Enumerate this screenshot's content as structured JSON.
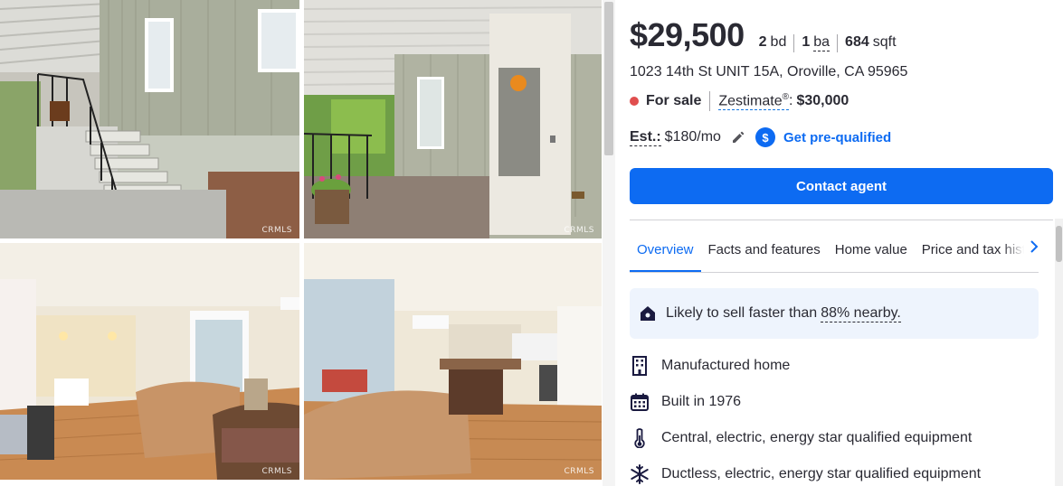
{
  "gallery": {
    "watermark": "CRMLS",
    "photos": [
      {
        "alt": "exterior-stairs"
      },
      {
        "alt": "front-door-porch"
      },
      {
        "alt": "living-room-window"
      },
      {
        "alt": "living-room-kitchen"
      }
    ]
  },
  "listing": {
    "price": "$29,500",
    "beds_value": "2",
    "beds_unit": "bd",
    "baths_value": "1",
    "baths_unit": "ba",
    "sqft_value": "684",
    "sqft_unit": "sqft",
    "address": "1023 14th St UNIT 15A, Oroville, CA 95965",
    "status": "For sale",
    "zestimate_label": "Zestimate",
    "zestimate_reg": "®",
    "zestimate_colon": ":",
    "zestimate_value": "$30,000",
    "est_label": "Est.:",
    "est_value": "$180/mo",
    "prequal_label": "Get pre-qualified",
    "dollar_glyph": "$",
    "contact_label": "Contact agent"
  },
  "tabs": [
    {
      "label": "Overview",
      "active": true
    },
    {
      "label": "Facts and features",
      "active": false
    },
    {
      "label": "Home value",
      "active": false
    },
    {
      "label": "Price and tax history",
      "active": false
    }
  ],
  "hint": {
    "text": "Likely to sell faster than",
    "percent": "88% nearby."
  },
  "features": [
    {
      "icon": "building-icon",
      "text": "Manufactured home"
    },
    {
      "icon": "calendar-icon",
      "text": "Built in 1976"
    },
    {
      "icon": "thermometer-icon",
      "text": "Central, electric, energy star qualified equipment"
    },
    {
      "icon": "snowflake-icon",
      "text": "Ductless, electric, energy star qualified equipment"
    }
  ],
  "colors": {
    "accent": "#0d6bf2",
    "status_dot": "#e04e4e",
    "hint_bg": "#eef4fd"
  }
}
